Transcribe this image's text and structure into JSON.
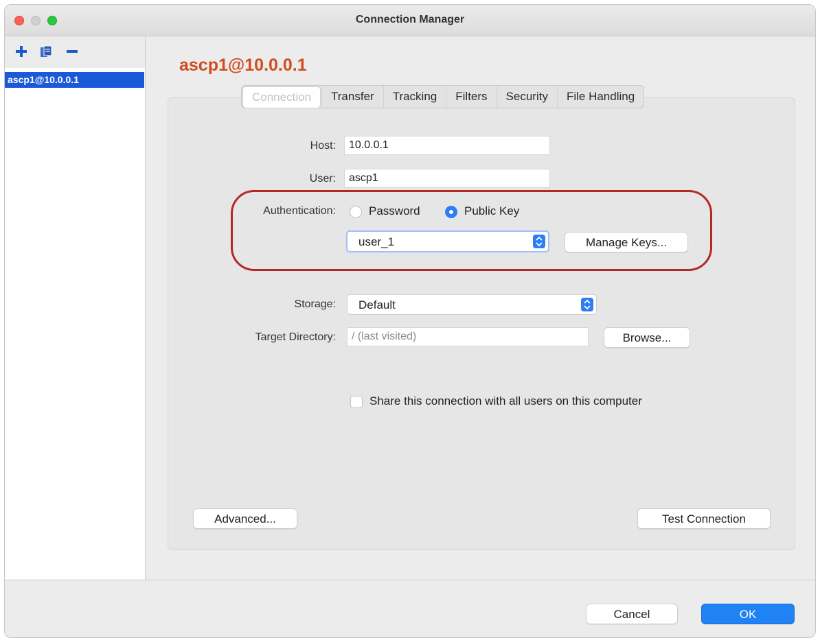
{
  "window": {
    "title": "Connection Manager"
  },
  "sidebar": {
    "tools": [
      "add-icon",
      "duplicate-icon",
      "remove-icon"
    ],
    "items": [
      {
        "label": "ascp1@10.0.0.1",
        "selected": true
      }
    ]
  },
  "connection": {
    "title": "ascp1@10.0.0.1",
    "tabs": [
      {
        "label": "Connection",
        "active": true
      },
      {
        "label": "Transfer"
      },
      {
        "label": "Tracking"
      },
      {
        "label": "Filters"
      },
      {
        "label": "Security"
      },
      {
        "label": "File Handling"
      }
    ],
    "host": {
      "label": "Host:",
      "value": "10.0.0.1"
    },
    "user": {
      "label": "User:",
      "value": "ascp1"
    },
    "authentication": {
      "label": "Authentication:",
      "options": [
        "Password",
        "Public Key"
      ],
      "selected": "Public Key",
      "key": "user_1",
      "manage_keys_label": "Manage Keys..."
    },
    "storage": {
      "label": "Storage:",
      "value": "Default"
    },
    "target_directory": {
      "label": "Target Directory:",
      "placeholder": "/ (last visited)",
      "browse_label": "Browse..."
    },
    "share": {
      "label": "Share this connection with all users on this computer",
      "checked": false
    },
    "advanced_label": "Advanced...",
    "test_connection_label": "Test Connection"
  },
  "footer": {
    "cancel_label": "Cancel",
    "ok_label": "OK"
  },
  "colors": {
    "accent": "#1f82f5",
    "title_orange": "#d24b1d",
    "highlight_red": "#b42824",
    "selection_blue": "#1b59d8"
  }
}
